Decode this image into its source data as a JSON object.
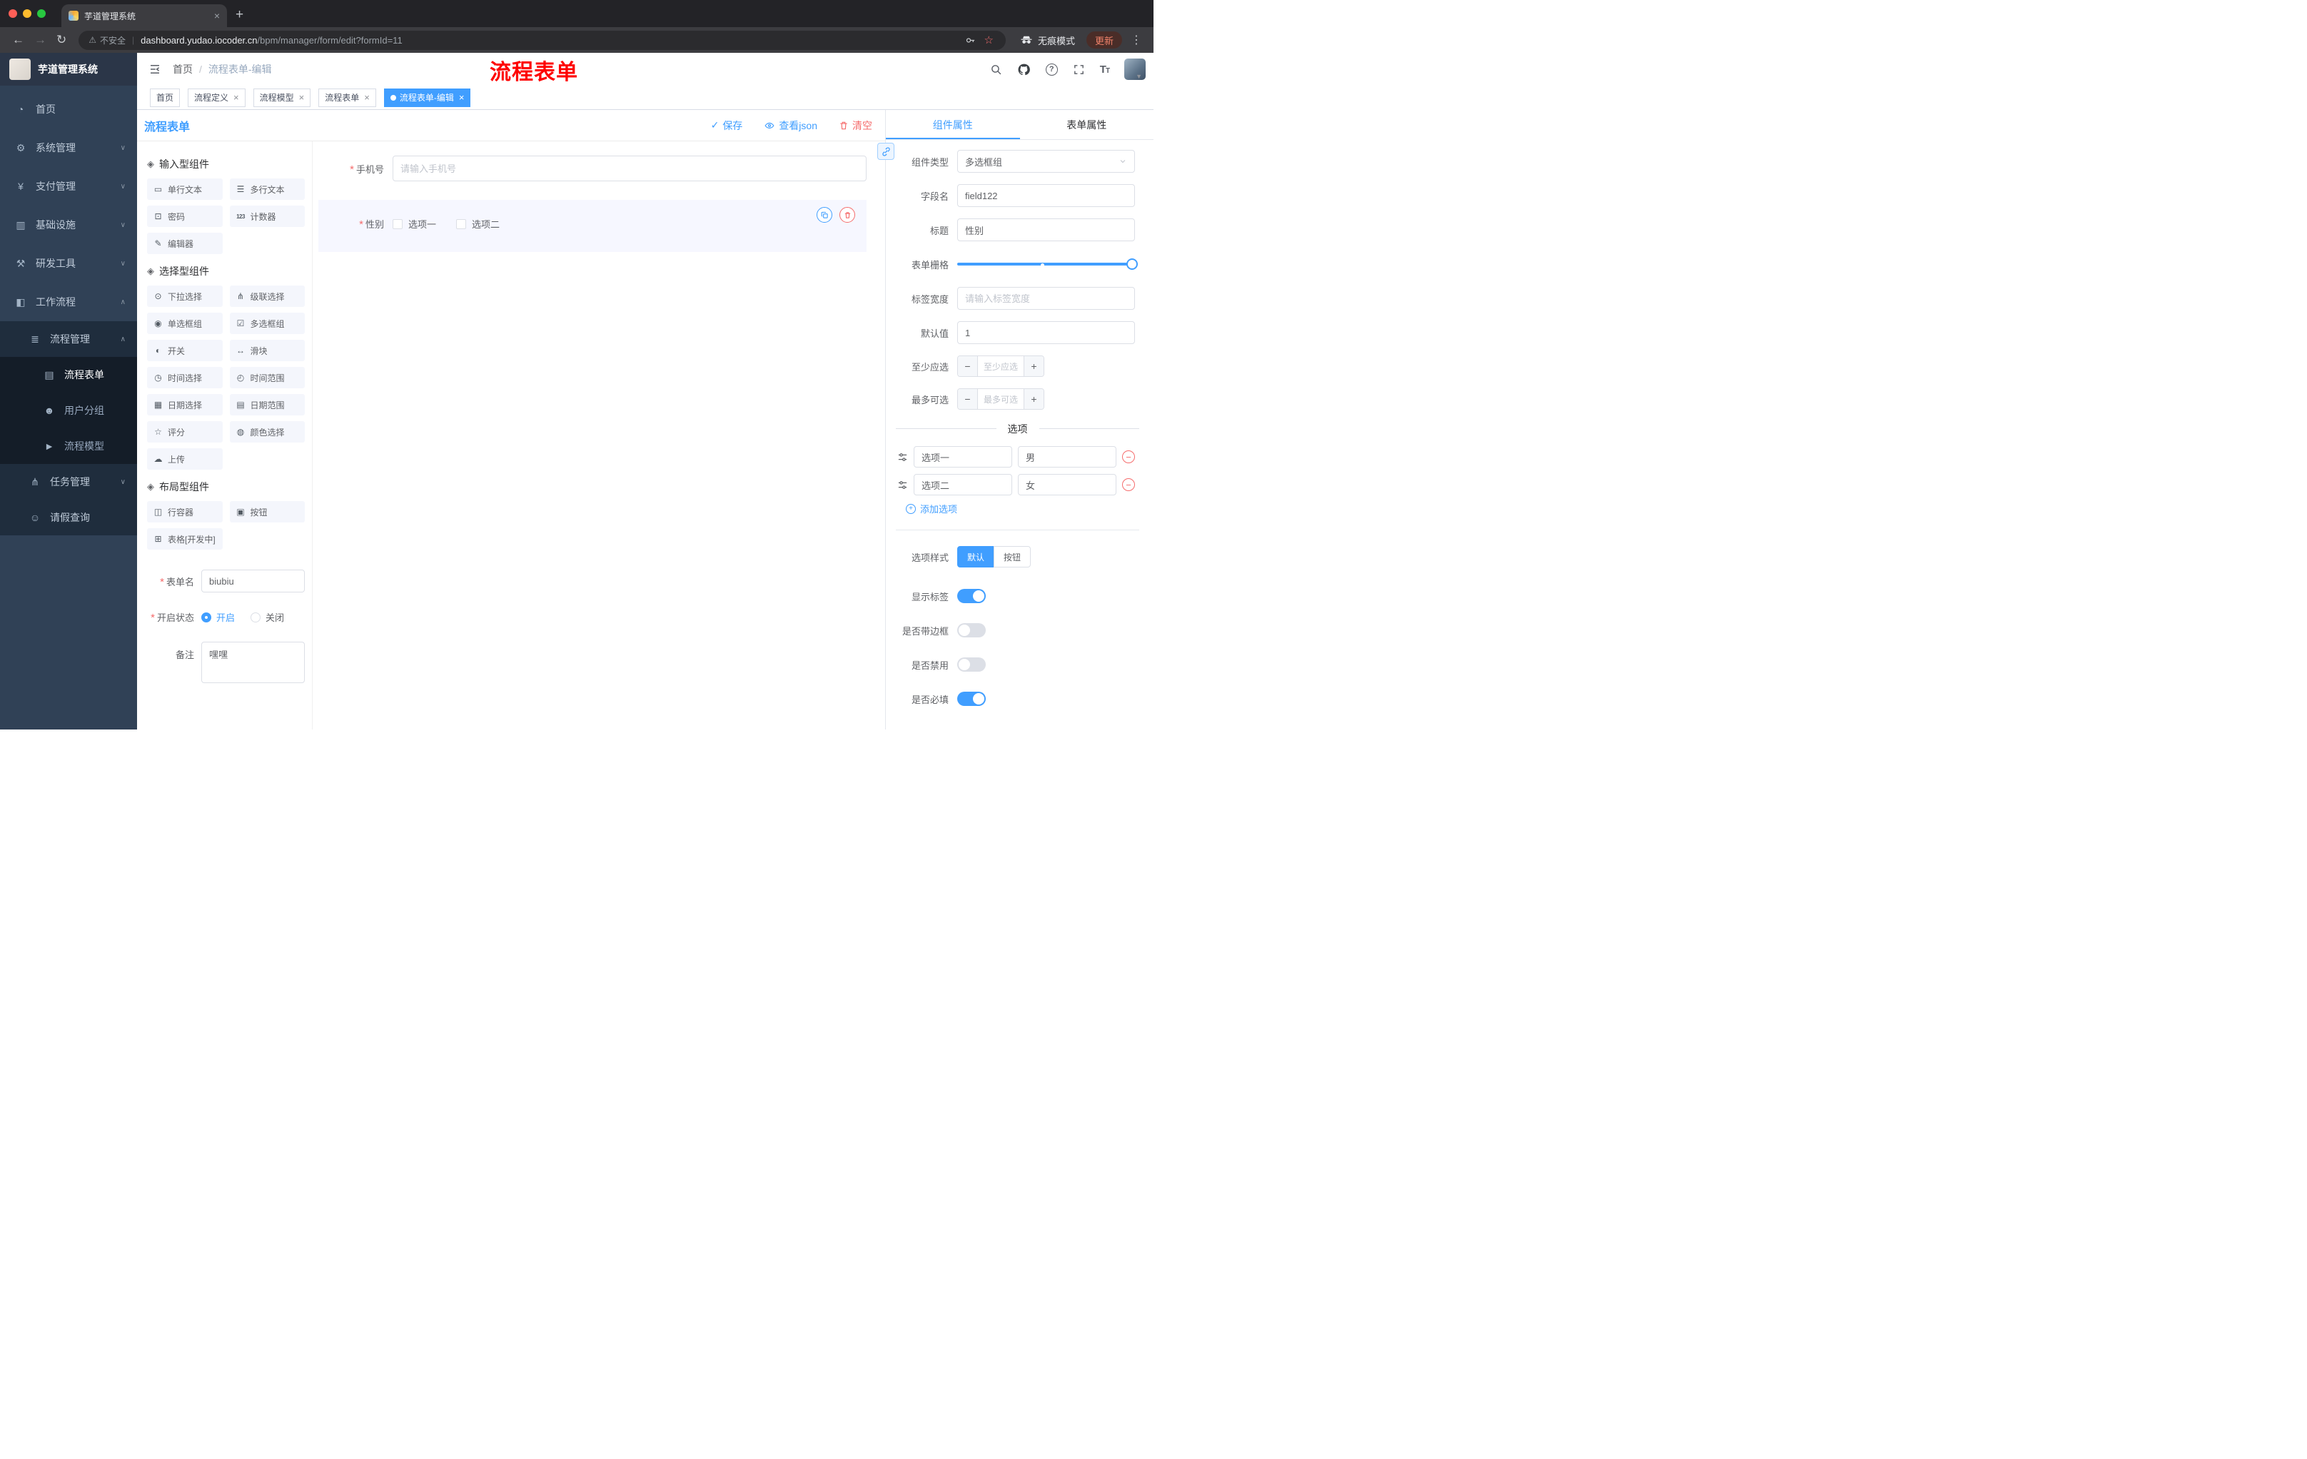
{
  "chrome": {
    "tab_title": "芋道管理系统",
    "security_label": "不安全",
    "url_host": "dashboard.yudao.iocoder.cn",
    "url_path": "/bpm/manager/form/edit?formId=11",
    "incognito_label": "无痕模式",
    "update_label": "更新"
  },
  "sidebar": {
    "logo_title": "芋道管理系统",
    "items": [
      {
        "label": "首页",
        "glyph": "◔"
      },
      {
        "label": "系统管理",
        "glyph": "⚙"
      },
      {
        "label": "支付管理",
        "glyph": "¥"
      },
      {
        "label": "基础设施",
        "glyph": "▥"
      },
      {
        "label": "研发工具",
        "glyph": "⚒"
      },
      {
        "label": "工作流程",
        "glyph": "◧"
      },
      {
        "label": "流程管理",
        "glyph": "≣"
      },
      {
        "label": "流程表单",
        "glyph": "▤"
      },
      {
        "label": "用户分组",
        "glyph": "☻"
      },
      {
        "label": "流程模型",
        "glyph": "►"
      },
      {
        "label": "任务管理",
        "glyph": "⋔"
      },
      {
        "label": "请假查询",
        "glyph": "☺"
      }
    ]
  },
  "header": {
    "breadcrumb_home": "首页",
    "breadcrumb_current": "流程表单-编辑",
    "annotation": "流程表单"
  },
  "tags": [
    {
      "label": "首页"
    },
    {
      "label": "流程定义"
    },
    {
      "label": "流程模型"
    },
    {
      "label": "流程表单"
    },
    {
      "label": "流程表单-编辑"
    }
  ],
  "designer": {
    "title": "流程表单",
    "save_label": "保存",
    "view_json_label": "查看json",
    "clear_label": "清空",
    "groups": [
      {
        "title": "输入型组件",
        "items": [
          {
            "label": "单行文本",
            "glyph": "▭"
          },
          {
            "label": "多行文本",
            "glyph": "☰"
          },
          {
            "label": "密码",
            "glyph": "⊡"
          },
          {
            "label": "计数器",
            "glyph": "123"
          },
          {
            "label": "编辑器",
            "glyph": "✎"
          }
        ]
      },
      {
        "title": "选择型组件",
        "items": [
          {
            "label": "下拉选择",
            "glyph": "⊙"
          },
          {
            "label": "级联选择",
            "glyph": "⋔"
          },
          {
            "label": "单选框组",
            "glyph": "◉"
          },
          {
            "label": "多选框组",
            "glyph": "☑"
          },
          {
            "label": "开关",
            "glyph": "◐"
          },
          {
            "label": "滑块",
            "glyph": "↔"
          },
          {
            "label": "时间选择",
            "glyph": "◷"
          },
          {
            "label": "时间范围",
            "glyph": "◴"
          },
          {
            "label": "日期选择",
            "glyph": "▦"
          },
          {
            "label": "日期范围",
            "glyph": "▤"
          },
          {
            "label": "评分",
            "glyph": "☆"
          },
          {
            "label": "颜色选择",
            "glyph": "◍"
          },
          {
            "label": "上传",
            "glyph": "☁"
          }
        ]
      },
      {
        "title": "布局型组件",
        "items": [
          {
            "label": "行容器",
            "glyph": "◫"
          },
          {
            "label": "按钮",
            "glyph": "▣"
          },
          {
            "label": "表格[开发中]",
            "glyph": "⊞"
          }
        ]
      }
    ],
    "meta": {
      "name_label": "表单名",
      "name_value": "biubiu",
      "status_label": "开启状态",
      "status_on": "开启",
      "status_off": "关闭",
      "remark_label": "备注",
      "remark_value": "嘿嘿"
    },
    "canvas": {
      "phone_label": "手机号",
      "phone_placeholder": "请输入手机号",
      "gender_label": "性别",
      "gender_opt1": "选项一",
      "gender_opt2": "选项二"
    }
  },
  "props": {
    "tab_component": "组件属性",
    "tab_form": "表单属性",
    "rows": {
      "type_label": "组件类型",
      "type_value": "多选框组",
      "field_label": "字段名",
      "field_value": "field122",
      "title_label": "标题",
      "title_value": "性别",
      "grid_label": "表单栅格",
      "width_label": "标签宽度",
      "width_placeholder": "请输入标签宽度",
      "default_label": "默认值",
      "default_value": "1",
      "min_label": "至少应选",
      "min_placeholder": "至少应选",
      "max_label": "最多可选",
      "max_placeholder": "最多可选"
    },
    "options": {
      "divider": "选项",
      "rows": [
        {
          "label": "选项一",
          "value": "男"
        },
        {
          "label": "选项二",
          "value": "女"
        }
      ],
      "add_label": "添加选项"
    },
    "style": {
      "label": "选项样式",
      "opt_default": "默认",
      "opt_button": "按钮"
    },
    "switches": [
      {
        "label": "显示标签"
      },
      {
        "label": "是否带边框"
      },
      {
        "label": "是否禁用"
      },
      {
        "label": "是否必填"
      }
    ]
  }
}
